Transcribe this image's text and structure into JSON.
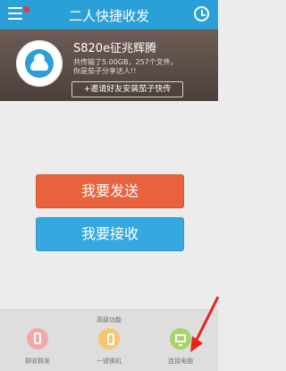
{
  "header": {
    "title": "二人快捷收发"
  },
  "profile": {
    "device_name": "S820e征兆辉腾",
    "stats_line1": "共传输了5.00GB，257个文件。",
    "stats_line2": "你是茄子分享达人!!",
    "invite_label": "+邀请好友安装茄子快传"
  },
  "actions": {
    "send_label": "我要发送",
    "receive_label": "我要接收"
  },
  "advanced": {
    "title": "高级功能",
    "tools": [
      {
        "label": "群收群发",
        "icon": "phone-group-icon"
      },
      {
        "label": "一键换机",
        "icon": "phone-switch-icon"
      },
      {
        "label": "连接电脑",
        "icon": "computer-icon"
      }
    ]
  },
  "colors": {
    "topbar": "#2a9fd8",
    "send": "#e8623d",
    "receive": "#36a8e0",
    "annotation_arrow": "#e8231d"
  }
}
